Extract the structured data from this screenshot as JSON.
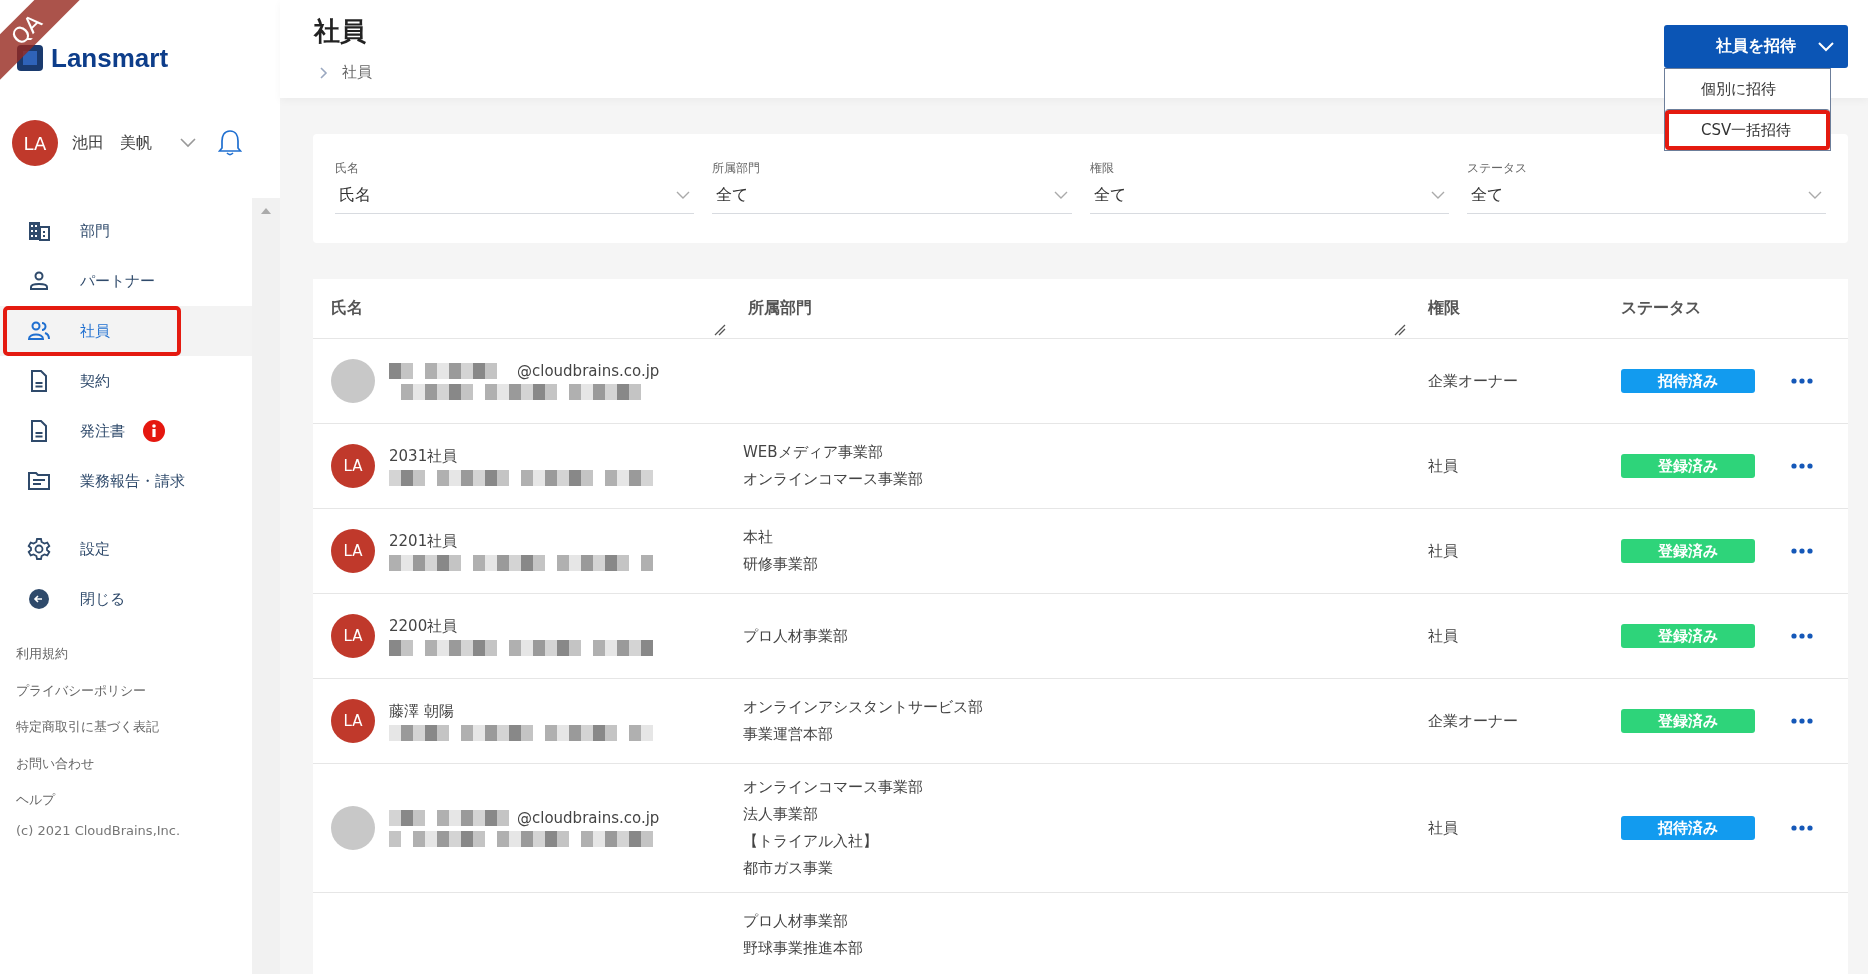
{
  "env_ribbon": "QA",
  "logo": "Lansmart",
  "user": {
    "initials": "LA",
    "name": "池田　美帆"
  },
  "nav": [
    {
      "label": "部門",
      "selected": false,
      "highlighted": false,
      "alert": false
    },
    {
      "label": "パートナー",
      "selected": false,
      "highlighted": false,
      "alert": false
    },
    {
      "label": "社員",
      "selected": true,
      "highlighted": true,
      "alert": false
    },
    {
      "label": "契約",
      "selected": false,
      "highlighted": false,
      "alert": false
    },
    {
      "label": "発注書",
      "selected": false,
      "highlighted": false,
      "alert": true
    },
    {
      "label": "業務報告・請求",
      "selected": false,
      "highlighted": false,
      "alert": false
    }
  ],
  "nav_bottom": [
    {
      "label": "設定"
    },
    {
      "label": "閉じる"
    }
  ],
  "footer_links": [
    "利用規約",
    "プライバシーポリシー",
    "特定商取引に基づく表記",
    "お問い合わせ",
    "ヘルプ"
  ],
  "copyright": "(c) 2021 CloudBrains,Inc.",
  "page_title": "社員",
  "breadcrumb": [
    "社員"
  ],
  "invite_button": "社員を招待",
  "invite_menu": [
    {
      "label": "個別に招待",
      "highlighted": false
    },
    {
      "label": "CSV一括招待",
      "highlighted": true
    }
  ],
  "filters": [
    {
      "label": "氏名",
      "value": "氏名"
    },
    {
      "label": "所属部門",
      "value": "全て"
    },
    {
      "label": "権限",
      "value": "全て"
    },
    {
      "label": "ステータス",
      "value": "全て"
    }
  ],
  "table": {
    "columns": [
      "氏名",
      "所属部門",
      "権限",
      "ステータス"
    ],
    "rows": [
      {
        "avatar": {
          "kind": "blank"
        },
        "email": "@cloudbrains.co.jp",
        "redacted": true,
        "role": "企業オーナー",
        "status": {
          "label": "招待済み",
          "kind": "invited"
        }
      },
      {
        "avatar": {
          "kind": "initials",
          "initials": "LA"
        },
        "name": "2031社員",
        "redacted": true,
        "departments": [
          "WEBメディア事業部",
          "オンラインコマース事業部"
        ],
        "role": "社員",
        "status": {
          "label": "登録済み",
          "kind": "registered"
        }
      },
      {
        "avatar": {
          "kind": "initials",
          "initials": "LA"
        },
        "name": "2201社員",
        "redacted": true,
        "departments": [
          "本社",
          "研修事業部"
        ],
        "role": "社員",
        "status": {
          "label": "登録済み",
          "kind": "registered"
        }
      },
      {
        "avatar": {
          "kind": "initials",
          "initials": "LA"
        },
        "name": "2200社員",
        "redacted": true,
        "departments": [
          "プロ人材事業部"
        ],
        "role": "社員",
        "status": {
          "label": "登録済み",
          "kind": "registered"
        }
      },
      {
        "avatar": {
          "kind": "initials",
          "initials": "LA"
        },
        "name": "藤澤 朝陽",
        "redacted": true,
        "departments": [
          "オンラインアシスタントサービス部",
          "事業運営本部"
        ],
        "role": "企業オーナー",
        "status": {
          "label": "登録済み",
          "kind": "registered"
        }
      },
      {
        "avatar": {
          "kind": "blank"
        },
        "email": "@cloudbrains.co.jp",
        "redacted": true,
        "departments": [
          "オンラインコマース事業部",
          "法人事業部",
          "【トライアル入社】",
          "都市ガス事業"
        ],
        "role": "社員",
        "status": {
          "label": "招待済み",
          "kind": "invited"
        }
      },
      {
        "redacted": false,
        "departments": [
          "プロ人材事業部",
          "野球事業推進本部"
        ]
      }
    ]
  }
}
